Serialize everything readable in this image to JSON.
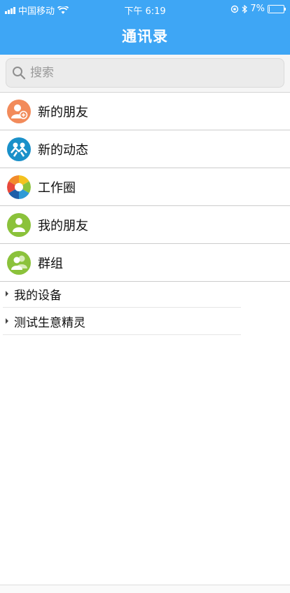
{
  "status_bar": {
    "carrier": "中国移动",
    "time": "下午 6:19",
    "battery": "7%",
    "battery_level": 0.07
  },
  "header": {
    "title": "通讯录"
  },
  "search": {
    "placeholder": "搜索",
    "value": ""
  },
  "menu": [
    {
      "label": "新的朋友",
      "icon": "add-friend-icon"
    },
    {
      "label": "新的动态",
      "icon": "people-feed-icon"
    },
    {
      "label": "工作圈",
      "icon": "aperture-icon"
    },
    {
      "label": "我的朋友",
      "icon": "person-icon"
    },
    {
      "label": "群组",
      "icon": "group-icon"
    }
  ],
  "groups": [
    {
      "label": "我的设备"
    },
    {
      "label": "测试生意精灵"
    }
  ],
  "colors": {
    "header": "#3ea6f5",
    "new_friends": "#f28b5b",
    "feed": "#1a90c9",
    "friends": "#8bc23b"
  }
}
